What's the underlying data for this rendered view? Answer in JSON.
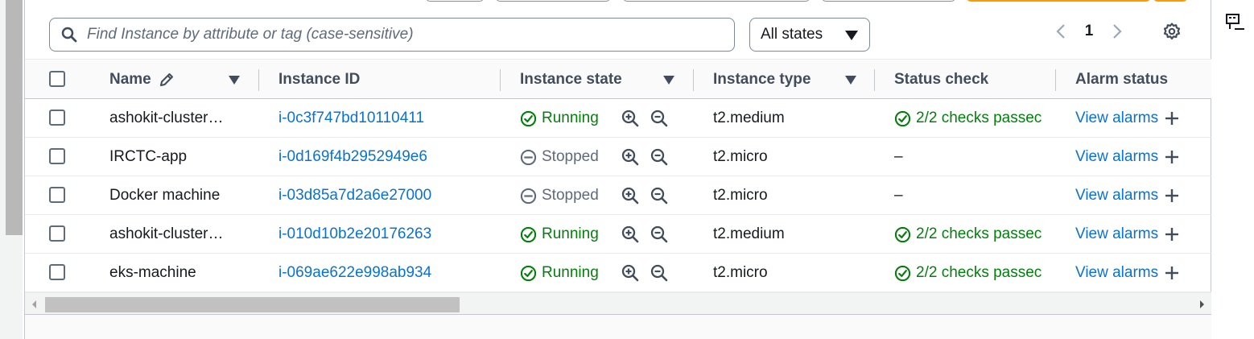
{
  "search": {
    "placeholder": "Find Instance by attribute or tag (case-sensitive)"
  },
  "state_filter": {
    "selected": "All states"
  },
  "pagination": {
    "current_page": "1"
  },
  "colors": {
    "link": "#0972d3",
    "running": "#037f0c",
    "stopped": "#5f6b7a",
    "header_text": "#414d5c"
  },
  "columns": [
    "Name",
    "Instance ID",
    "Instance state",
    "Instance type",
    "Status check",
    "Alarm status"
  ],
  "rows": [
    {
      "name": "ashokit-cluster…",
      "instance_id": "i-0c3f747bd10110411",
      "state": "Running",
      "type": "t2.medium",
      "status_check": "2/2 checks passec",
      "alarm": "View alarms"
    },
    {
      "name": "IRCTC-app",
      "instance_id": "i-0d169f4b2952949e6",
      "state": "Stopped",
      "type": "t2.micro",
      "status_check": "–",
      "alarm": "View alarms"
    },
    {
      "name": "Docker machine",
      "instance_id": "i-03d85a7d2a6e27000",
      "state": "Stopped",
      "type": "t2.micro",
      "status_check": "–",
      "alarm": "View alarms"
    },
    {
      "name": "ashokit-cluster…",
      "instance_id": "i-010d10b2e20176263",
      "state": "Running",
      "type": "t2.medium",
      "status_check": "2/2 checks passec",
      "alarm": "View alarms"
    },
    {
      "name": "eks-machine",
      "instance_id": "i-069ae622e998ab934",
      "state": "Running",
      "type": "t2.micro",
      "status_check": "2/2 checks passec",
      "alarm": "View alarms"
    }
  ],
  "icons": {
    "search": "search-icon",
    "filter_caret": "caret-down-icon",
    "prev": "chevron-left-icon",
    "next": "chevron-right-icon",
    "settings": "gear-icon",
    "edit": "pencil-icon",
    "running": "check-circle-icon",
    "stopped": "minus-circle-icon",
    "zoom_in": "zoom-in-icon",
    "zoom_out": "zoom-out-icon",
    "add": "plus-icon",
    "side": "feedback-icon"
  }
}
